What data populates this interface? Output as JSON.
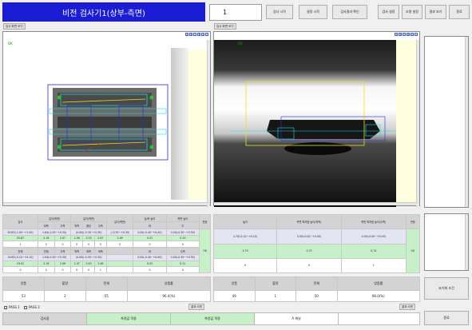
{
  "header": {
    "title": "비전 검사기1(상부-측면)",
    "count_value": "1"
  },
  "top_buttons": [
    "검사 시작",
    "설정 시작",
    "검사결과 확인",
    "검사 설정",
    "조명 설정",
    "결과 보기",
    "종료"
  ],
  "left_view": {
    "label_button": "검사 화면 보기",
    "tag": "OK"
  },
  "right_view": {
    "label_button": "검사 화면 보기",
    "tag": "OK"
  },
  "toolbar_glyphs": [
    "+",
    "↕",
    "−",
    "↕",
    "+",
    "−"
  ],
  "left_table": {
    "rows": [
      [
        "검사",
        "길이(측면)",
        "",
        "길이(측면)",
        "",
        "",
        "길이(측면)",
        "상/하 높이",
        "측면 높이",
        "판정"
      ],
      [
        "",
        "좌측",
        "우측",
        "좌측",
        "중앙",
        "우측",
        "",
        "좌",
        "우",
        ""
      ],
      [
        "20.83(-1.00~+1.00)",
        "1.84(-0.30~+0.30)",
        "",
        "(4.00)(-0.30~+0.30)",
        "",
        "",
        "-(-0.30~+0.30)",
        "0.00(-0.40~+0.40)",
        "0.00(-0.30~+0.30)",
        ""
      ],
      [
        "20.87",
        "2.16",
        "2.07",
        "2.56",
        "2.33",
        "2.67",
        "1.49",
        "0.31",
        "0.19",
        "OK"
      ],
      [
        "1",
        "0",
        "0",
        "0",
        "0",
        "0",
        "0",
        "0",
        "0",
        ""
      ],
      [
        "전체",
        "전체",
        "우측",
        "좌측",
        "좌측",
        "좌측",
        "",
        "좌",
        "우측",
        ""
      ],
      [
        "19.83(-0.10~+0.10)",
        "1.94(-0.30~+0.30)",
        "",
        "(4.00)(-0.30~+0.30)",
        "",
        "",
        "",
        "0.00(-0.40~+0.40)",
        "0.00(-0.30~+0.30)",
        ""
      ],
      [
        "19.41",
        "2.16",
        "2.06",
        "2.47",
        "2.40",
        "2.46",
        "",
        "0.22",
        "0.11",
        ""
      ],
      [
        "0",
        "0",
        "0",
        "0",
        "0",
        "1",
        "",
        "0",
        "0",
        ""
      ]
    ],
    "judge": "OK"
  },
  "right_table": {
    "rows": [
      [
        "높이",
        "측면 최하점 높이(좌측)",
        "측면 최하점 높이(우측)",
        "판정"
      ],
      [
        "4.70(-0.10~+0.10)",
        "0.00(-0.00~+0.00)",
        "0.00(-0.00~+0.00)",
        ""
      ],
      [
        "4.70",
        "0.75",
        "0.74",
        "OK"
      ],
      [
        "0",
        "0",
        "1",
        ""
      ]
    ]
  },
  "left_stats": {
    "headers": [
      "양품",
      "불량",
      "전체",
      "양품률"
    ],
    "values": [
      "53",
      "2",
      "55",
      "96.4(%)"
    ]
  },
  "right_stats": {
    "headers": [
      "양품",
      "불량",
      "전체",
      "양품률"
    ],
    "values": [
      "49",
      "1",
      "50",
      "98.0(%)"
    ]
  },
  "checkboxes": [
    "PASS 1",
    "PASS 2"
  ],
  "reset_left": "결과 리셋",
  "reset_right": "결과 리셋",
  "bottom_bar": [
    "검사중",
    "측정값 적용",
    "측정값 적용",
    "A 채널"
  ],
  "side_button": "초기화 조건",
  "side_end_button": "종료"
}
